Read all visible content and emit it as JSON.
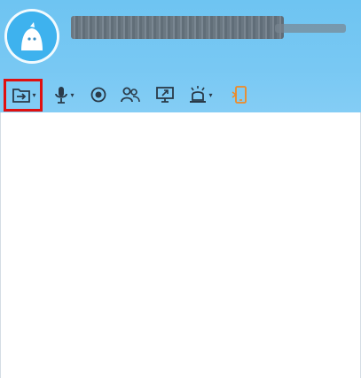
{
  "window": {
    "title": ""
  },
  "header": {
    "avatar_alt": "avatar",
    "name": ""
  },
  "toolbar": {
    "items": [
      {
        "name": "transfer-file",
        "icon": "file-transfer-icon",
        "has_dropdown": true
      },
      {
        "name": "voice-call",
        "icon": "microphone-icon",
        "has_dropdown": true
      },
      {
        "name": "video-call",
        "icon": "camera-icon",
        "has_dropdown": false
      },
      {
        "name": "multi-person-chat",
        "icon": "people-icon",
        "has_dropdown": false
      },
      {
        "name": "remote-desktop",
        "icon": "screen-share-icon",
        "has_dropdown": false
      },
      {
        "name": "app-center",
        "icon": "alarm-icon",
        "has_dropdown": true
      },
      {
        "name": "send-to-phone",
        "icon": "phone-icon",
        "has_dropdown": false
      }
    ],
    "dropdown_glyph": "▾"
  },
  "colors": {
    "header_top": "#6ec4f2",
    "header_bottom": "#84cdf5",
    "highlight": "#e01010",
    "icon": "#2a3a48",
    "phone_icon": "#f08a24"
  }
}
